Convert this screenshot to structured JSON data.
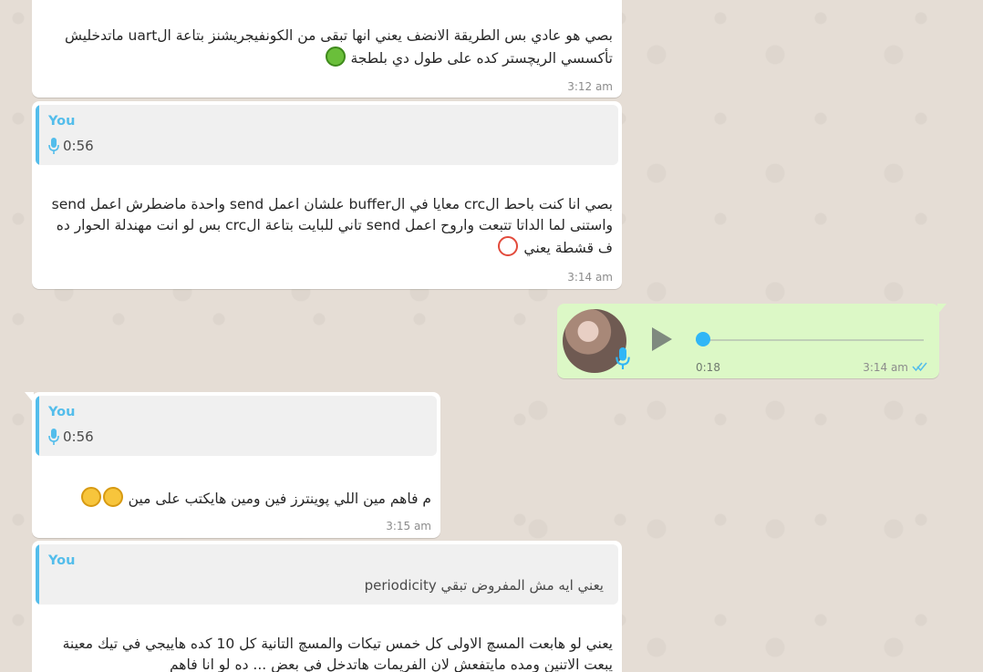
{
  "messages": [
    {
      "text": "بصي هو عادي بس الطريقة الانضف يعني انها تبقى من الكونفيجريشنز بتاعة الuart ماتدخليش تأكسسي الريچستر كده على طول دي بلطجة",
      "emoji": "frog-emoji",
      "time": "3:12 am"
    },
    {
      "quote": {
        "author": "You",
        "duration": "0:56"
      },
      "text": "بصي انا كنت باحط الcrc معايا في الbuffer علشان اعمل send واحدة ماضطرش اعمل send واستنى لما الداتا تتبعت واروح اعمل send تاني للبايت بتاعة الcrc بس لو انت مهندلة الحوار ده ف قشطة يعني",
      "emoji": "chicken-emoji",
      "time": "3:14 am"
    },
    {
      "voice": {
        "duration": "0:18"
      },
      "time": "3:14 am",
      "status": "read"
    },
    {
      "quote": {
        "author": "You",
        "duration": "0:56"
      },
      "text": "م فاهم مين اللي پوينترز فين ومين هايكتب على مين",
      "emoji": "laughing-emoji",
      "time": "3:15 am"
    },
    {
      "quote": {
        "author": "You",
        "text": "يعني ايه مش المفروض تبقي periodicity"
      },
      "text": "يعني لو هابعت المسچ الاولى كل خمس تيكات والمسچ التانية كل 10 كده هاييجي في تيك معينة يبعت الاتنين ومده مايتفعش لان الفريمات هاتدخل في بعض ... ده لو انا فاهم"
    }
  ],
  "colors": {
    "wallpaper": "#e5ddd5",
    "incoming": "#ffffff",
    "outgoing": "#dcf8c6",
    "quote_accent": "#53bdeb",
    "read_ticks": "#53bdeb",
    "voice_progress": "#30b6f6"
  }
}
